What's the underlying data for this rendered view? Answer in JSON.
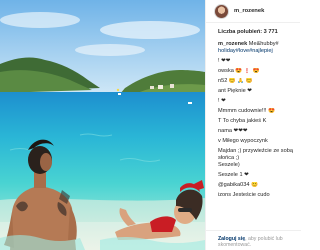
{
  "post": {
    "username": "m_rozenek",
    "likes_text": "Liczba polubień: 3 771",
    "caption": {
      "user": "m_rozenek",
      "text": "Me&hubby#",
      "hashtags": "holiday#love#najlepiej"
    },
    "comments": [
      {
        "text": "! ❤❤"
      },
      {
        "text": "owska 😍 ❗ 😍"
      },
      {
        "text": "n52 😊 🙏 😊"
      },
      {
        "text": "ant Pięknie ❤"
      },
      {
        "text": "! ❤"
      },
      {
        "text": "Mmmm cudownie!!! 😍"
      },
      {
        "text": "T To chyba jakieś K"
      },
      {
        "text": "nama ❤❤❤"
      },
      {
        "text": "v Miłego wypoczynk"
      },
      {
        "text": "Majdan ;) przywieźcie ze sobą słońca ;)"
      },
      {
        "text": "Seszele)"
      },
      {
        "text": "Seszele 1 ❤"
      },
      {
        "text": "@gabika034 😊"
      },
      {
        "text": "izons Jesteście cudo"
      }
    ],
    "footer": {
      "login_link": "Zaloguj się",
      "rest": ", aby polubić lub skomentować."
    }
  },
  "colors": {
    "sky": "#9ecdf0",
    "sea_light": "#3fd0d8",
    "sea_deep": "#1f8fd0",
    "link": "#003569"
  },
  "icons": {
    "avatar": "profile-avatar-icon"
  }
}
